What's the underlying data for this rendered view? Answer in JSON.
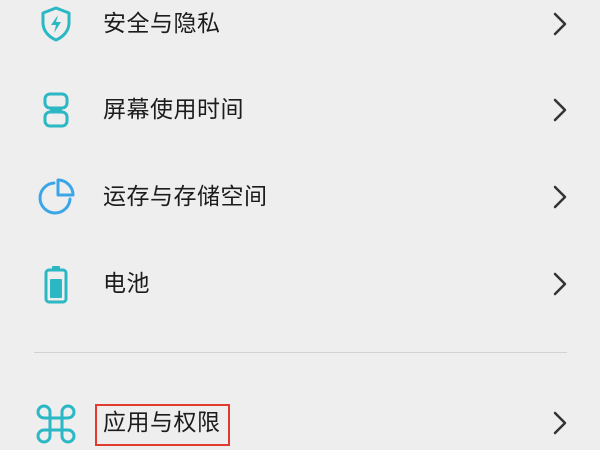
{
  "accent_color": "#2bb8c4",
  "highlight_color": "#e23a2e",
  "menu": {
    "items": [
      {
        "label": "安全与隐私",
        "icon": "shield-icon"
      },
      {
        "label": "屏幕使用时间",
        "icon": "hourglass-icon"
      },
      {
        "label": "运存与存储空间",
        "icon": "pie-chart-icon"
      },
      {
        "label": "电池",
        "icon": "battery-icon"
      },
      {
        "label": "应用与权限",
        "icon": "apps-icon"
      }
    ]
  }
}
